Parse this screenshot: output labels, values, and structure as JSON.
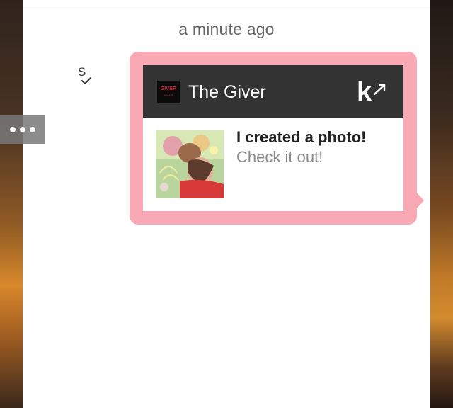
{
  "chat": {
    "timestamp": "a minute ago",
    "status_label": "S"
  },
  "card": {
    "app_name": "The Giver",
    "logo_text": "GIVER",
    "logo_subtext": "2 0 1 4",
    "title": "I created a photo!",
    "subtitle": "Check it out!",
    "bubble_color": "#f9a9b4",
    "header_color": "#333333"
  },
  "icons": {
    "more": "more-dots-icon",
    "status": "sent-check-icon",
    "share": "k-share-icon"
  }
}
